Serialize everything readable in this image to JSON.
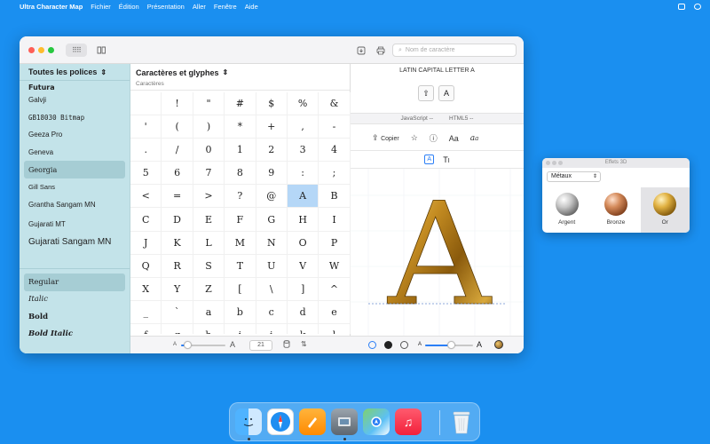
{
  "menubar": {
    "app_name": "Ultra Character Map",
    "items": [
      "Fichier",
      "Édition",
      "Présentation",
      "Aller",
      "Fenêtre",
      "Aide"
    ]
  },
  "toolbar": {
    "search_placeholder": "Nom de caractère"
  },
  "sidebar": {
    "header": "Toutes les polices",
    "fonts": [
      "Futura",
      "Galvji",
      "GB18030 Bitmap",
      "Geeza Pro",
      "Geneva",
      "Georgia",
      "Gill Sans",
      "Grantha Sangam MN",
      "Gujarati MT",
      "Gujarati Sangam MN"
    ],
    "selected_font": "Georgia",
    "styles": [
      "Regular",
      "Italic",
      "Bold",
      "Bold Italic"
    ],
    "selected_style": "Regular"
  },
  "glyph_pane": {
    "title": "Caractères et glyphes",
    "subtitle": "Caractères",
    "glyphs": [
      "",
      "!",
      "\"",
      "#",
      "$",
      "%",
      "&",
      "'",
      "(",
      ")",
      "*",
      "+",
      ",",
      "-",
      ".",
      "/",
      "0",
      "1",
      "2",
      "3",
      "4",
      "5",
      "6",
      "7",
      "8",
      "9",
      ":",
      ";",
      "<",
      "=",
      ">",
      "?",
      "@",
      "A",
      "B",
      "C",
      "D",
      "E",
      "F",
      "G",
      "H",
      "I",
      "J",
      "K",
      "L",
      "M",
      "N",
      "O",
      "P",
      "Q",
      "R",
      "S",
      "T",
      "U",
      "V",
      "W",
      "X",
      "Y",
      "Z",
      "[",
      "\\",
      "]",
      "^",
      "_",
      "`",
      "a",
      "b",
      "c",
      "d",
      "e",
      "f",
      "g",
      "h",
      "i",
      "j",
      "k",
      "l"
    ],
    "selected_glyph": "A",
    "font_size": "21",
    "size_small_label": "A",
    "size_large_label": "A",
    "size_slider_level": 0.15
  },
  "detail": {
    "char_name": "LATIN CAPITAL LETTER A",
    "char": "A",
    "js_label": "JavaScript",
    "js_value": "--",
    "html_label": "HTML5",
    "html_value": "--",
    "copy_label": "Copier",
    "aa_label": "Aa",
    "preview_char": "A",
    "zoom_slider_level": 0.55,
    "zoom_small_label": "A",
    "zoom_large_label": "A"
  },
  "effects": {
    "title": "Effets 3D",
    "category": "Métaux",
    "items": [
      "Argent",
      "Bronze",
      "Or"
    ],
    "selected": "Or"
  },
  "dock": {
    "apps": [
      "finder-icon",
      "safari-icon",
      "pages-icon",
      "preview-icon",
      "maps-icon",
      "music-icon",
      "trash-icon"
    ]
  }
}
